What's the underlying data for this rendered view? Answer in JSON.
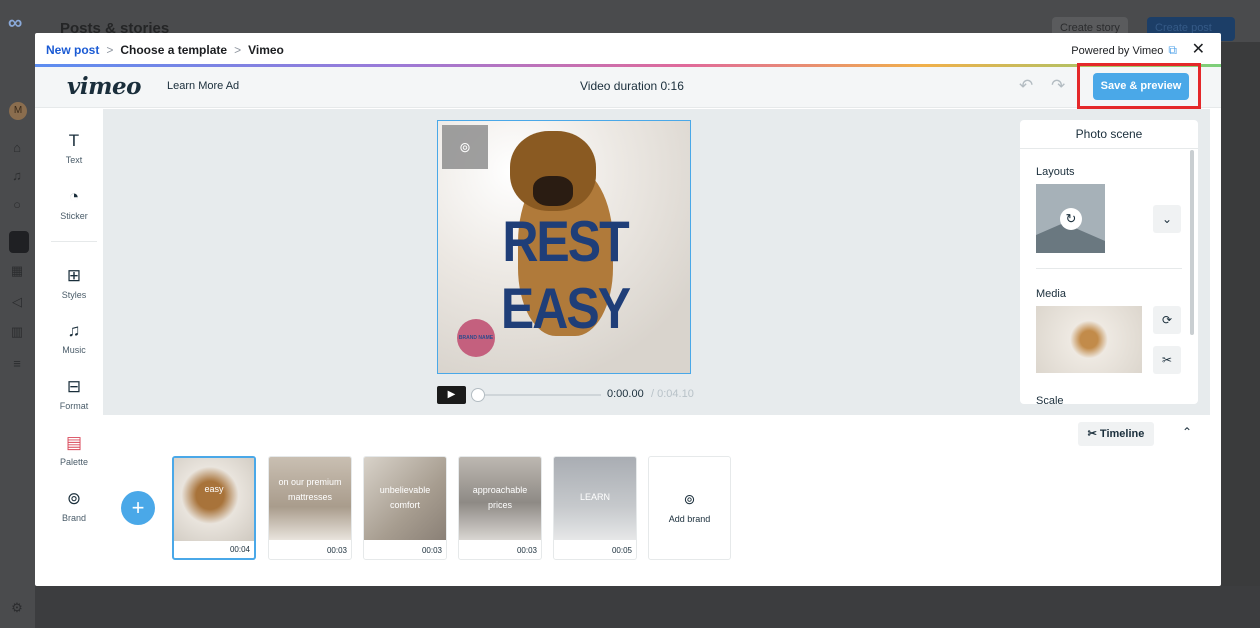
{
  "background": {
    "title": "Posts & stories",
    "create_story": "Create story",
    "create_post": "Create post",
    "avatar_letter": "M"
  },
  "breadcrumb": {
    "new_post": "New post",
    "choose_template": "Choose a template",
    "vimeo": "Vimeo"
  },
  "powered_by": "Powered by Vimeo",
  "editor": {
    "logo": "vimeo",
    "ad_name": "Learn More Ad",
    "duration": "Video duration 0:16",
    "save_label": "Save & preview"
  },
  "tools": [
    {
      "label": "Text",
      "icon": "T"
    },
    {
      "label": "Sticker",
      "icon": "◔"
    },
    {
      "label": "Styles",
      "icon": "⊞"
    },
    {
      "label": "Music",
      "icon": "♫"
    },
    {
      "label": "Format",
      "icon": "⊟"
    },
    {
      "label": "Palette",
      "icon": "▤"
    },
    {
      "label": "Brand",
      "icon": "⊚"
    }
  ],
  "canvas": {
    "headline": "REST EASY",
    "badge_text": "BRAND NAME",
    "time_current": "0:00.00",
    "time_total": "/ 0:04.10"
  },
  "panel": {
    "title": "Photo scene",
    "layouts_label": "Layouts",
    "media_label": "Media",
    "scale_label": "Scale"
  },
  "timeline": {
    "button_label": "Timeline",
    "scenes": [
      {
        "text": "easy",
        "duration": "00:04"
      },
      {
        "text": "on our premium mattresses",
        "duration": "00:03"
      },
      {
        "text": "unbelievable comfort",
        "duration": "00:03"
      },
      {
        "text": "approachable prices",
        "duration": "00:03"
      },
      {
        "text": "LEARN",
        "duration": "00:05"
      }
    ],
    "add_brand_label": "Add brand"
  }
}
